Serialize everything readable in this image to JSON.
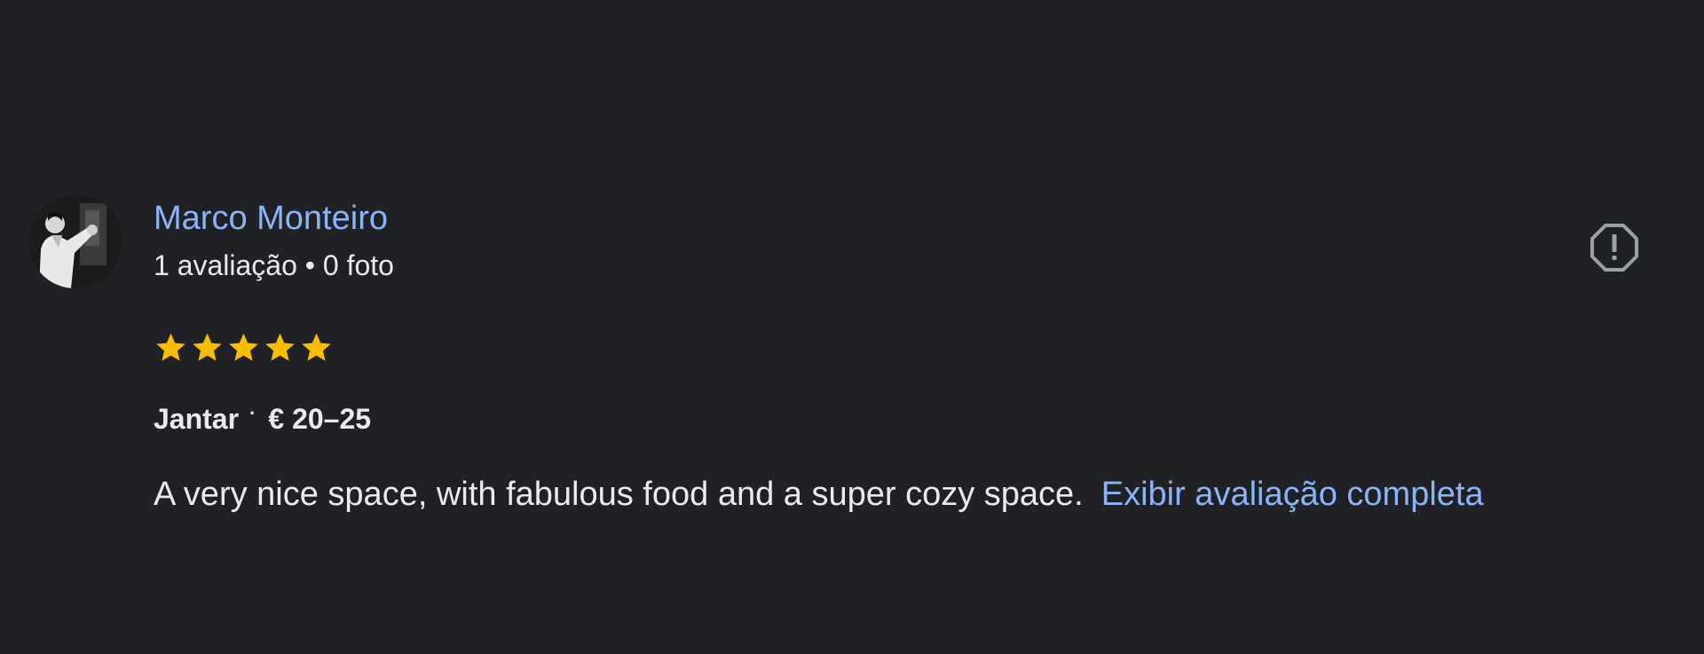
{
  "reviewer": {
    "name": "Marco Monteiro",
    "meta": "1 avaliação • 0 foto",
    "avatar_icon": "person-photo-avatar"
  },
  "actions": {
    "report_icon": "report-alert-icon"
  },
  "rating": {
    "value": 5,
    "max": 5,
    "star_color": "#fbbc04"
  },
  "meal": {
    "type": "Jantar",
    "separator": "·",
    "price": "€ 20–25"
  },
  "review": {
    "text": "A very nice space, with fabulous food and a super cozy space.",
    "expand_label": "Exibir avaliação completa"
  },
  "colors": {
    "background": "#202124",
    "link": "#8ab4f8",
    "text": "#e8eaed"
  }
}
